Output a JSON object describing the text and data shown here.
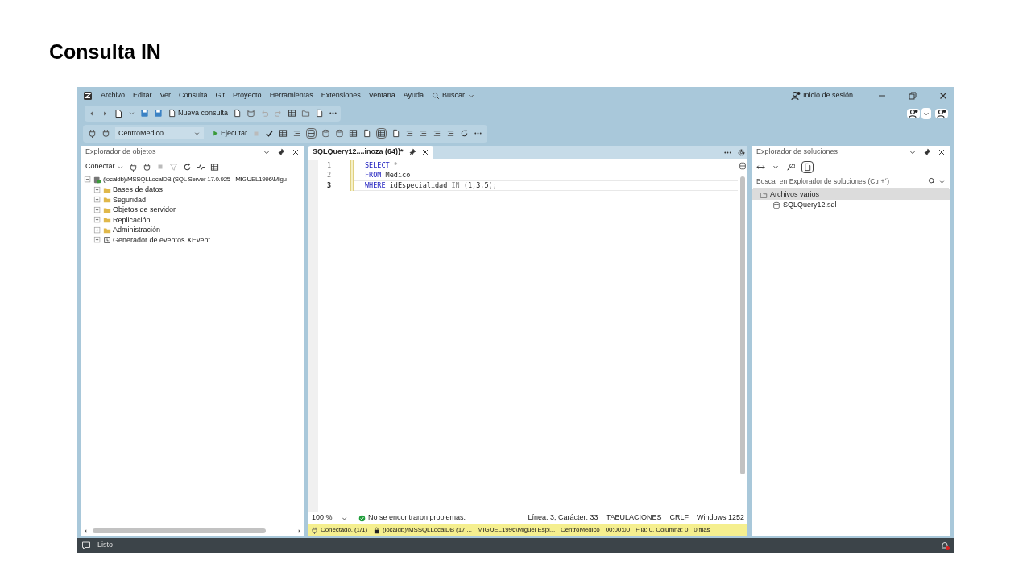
{
  "slide_title": "Consulta IN",
  "menu": [
    "Archivo",
    "Editar",
    "Ver",
    "Consulta",
    "Git",
    "Proyecto",
    "Herramientas",
    "Extensiones",
    "Ventana",
    "Ayuda"
  ],
  "search_label": "Buscar",
  "sign_in": "Inicio de sesión",
  "toolbar": {
    "new_query": "Nueva consulta",
    "database": "CentroMedico",
    "execute": "Ejecutar"
  },
  "object_explorer": {
    "title": "Explorador de objetos",
    "connect": "Conectar",
    "server": {
      "label": "(localdb)\\MSSQLLocalDB (SQL Server 17.0.925 - MIGUEL1996\\Migu",
      "expanded": true,
      "children": [
        {
          "label": "Bases de datos",
          "kind": "folder",
          "expanded": false
        },
        {
          "label": "Seguridad",
          "kind": "folder",
          "expanded": false
        },
        {
          "label": "Objetos de servidor",
          "kind": "folder",
          "expanded": false
        },
        {
          "label": "Replicación",
          "kind": "folder",
          "expanded": false
        },
        {
          "label": "Administración",
          "kind": "folder",
          "expanded": false
        },
        {
          "label": "Generador de eventos XEvent",
          "kind": "xevent",
          "expanded": false
        }
      ]
    }
  },
  "editor": {
    "tab": {
      "title": "SQLQuery12....inoza (64))*",
      "selected": true
    },
    "lines": [
      {
        "number": "1",
        "current": false,
        "tokens": [
          {
            "text": "SELECT",
            "kind": "keyword"
          },
          {
            "text": " *",
            "kind": "operator"
          }
        ]
      },
      {
        "number": "2",
        "current": false,
        "tokens": [
          {
            "text": "FROM",
            "kind": "keyword"
          },
          {
            "text": " Medico",
            "kind": "plain"
          }
        ]
      },
      {
        "number": "3",
        "current": true,
        "tokens": [
          {
            "text": "WHERE",
            "kind": "keyword"
          },
          {
            "text": " idEspecialidad ",
            "kind": "plain"
          },
          {
            "text": "IN",
            "kind": "operator"
          },
          {
            "text": " (",
            "kind": "operator"
          },
          {
            "text": "1",
            "kind": "plain"
          },
          {
            "text": ",",
            "kind": "operator"
          },
          {
            "text": "3",
            "kind": "plain"
          },
          {
            "text": ",",
            "kind": "operator"
          },
          {
            "text": "5",
            "kind": "plain"
          },
          {
            "text": ");",
            "kind": "operator"
          }
        ]
      }
    ],
    "zoom": "100 %",
    "issues": "No se encontraron problemas.",
    "position": "Línea: 3, Carácter: 33",
    "tabs_mode": "TABULACIONES",
    "line_ending": "CRLF",
    "encoding": "Windows 1252"
  },
  "query_status": [
    {
      "text": "Conectado. (1/1)",
      "kind": "connection"
    },
    {
      "text": "(localdb)\\MSSQLLocalDB (17....",
      "kind": "server"
    },
    {
      "text": "MIGUEL1996\\Miguel Espi...",
      "kind": "plain"
    },
    {
      "text": "CentroMedico",
      "kind": "plain"
    },
    {
      "text": "00:00:00",
      "kind": "plain"
    },
    {
      "text": "Fila: 0, Columna: 0",
      "kind": "plain"
    },
    {
      "text": "0 filas",
      "kind": "plain"
    }
  ],
  "solution_explorer": {
    "title": "Explorador de soluciones",
    "search_placeholder": "Buscar en Explorador de soluciones (Ctrl+´)",
    "items": [
      {
        "label": "Archivos varios",
        "selected": true,
        "children": [
          {
            "label": "SQLQuery12.sql",
            "selected": false
          }
        ]
      }
    ]
  },
  "status_bar": {
    "text": "Listo"
  }
}
